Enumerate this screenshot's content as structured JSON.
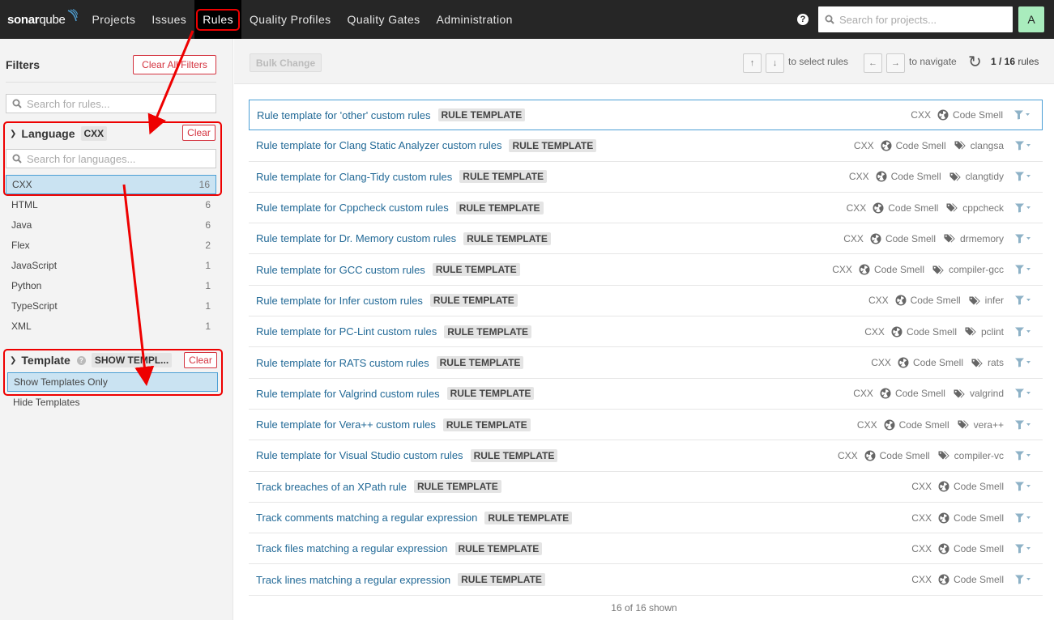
{
  "navbar": {
    "logo_sonar": "sonar",
    "logo_qube": "qube",
    "items": [
      {
        "label": "Projects"
      },
      {
        "label": "Issues"
      },
      {
        "label": "Rules",
        "active": true
      },
      {
        "label": "Quality Profiles"
      },
      {
        "label": "Quality Gates"
      },
      {
        "label": "Administration"
      }
    ],
    "help_icon": "?",
    "search_placeholder": "Search for projects...",
    "avatar_letter": "A"
  },
  "sidebar": {
    "title": "Filters",
    "clear_all_label": "Clear All Filters",
    "rule_search_placeholder": "Search for rules...",
    "language_facet": {
      "title": "Language",
      "badge": "CXX",
      "clear_label": "Clear",
      "search_placeholder": "Search for languages...",
      "items": [
        {
          "label": "CXX",
          "count": "16",
          "selected": true
        },
        {
          "label": "HTML",
          "count": "6"
        },
        {
          "label": "Java",
          "count": "6"
        },
        {
          "label": "Flex",
          "count": "2"
        },
        {
          "label": "JavaScript",
          "count": "1"
        },
        {
          "label": "Python",
          "count": "1"
        },
        {
          "label": "TypeScript",
          "count": "1"
        },
        {
          "label": "XML",
          "count": "1"
        }
      ]
    },
    "template_facet": {
      "title": "Template",
      "help": "?",
      "badge": "SHOW TEMPL...",
      "clear_label": "Clear",
      "items": [
        {
          "label": "Show Templates Only",
          "selected": true
        },
        {
          "label": "Hide Templates"
        }
      ]
    }
  },
  "toolbar": {
    "bulk_change_label": "Bulk Change",
    "key_up": "↑",
    "key_down": "↓",
    "select_hint": "to select rules",
    "key_left": "←",
    "key_right": "→",
    "navigate_hint": "to navigate",
    "refresh_icon": "↻",
    "pager_current": "1 / 16",
    "pager_suffix": "rules"
  },
  "rules": [
    {
      "name": "Rule template for 'other' custom rules",
      "badge": "RULE TEMPLATE",
      "lang": "CXX",
      "type": "Code Smell",
      "tag": ""
    },
    {
      "name": "Rule template for Clang Static Analyzer custom rules",
      "badge": "RULE TEMPLATE",
      "lang": "CXX",
      "type": "Code Smell",
      "tag": "clangsa"
    },
    {
      "name": "Rule template for Clang-Tidy custom rules",
      "badge": "RULE TEMPLATE",
      "lang": "CXX",
      "type": "Code Smell",
      "tag": "clangtidy"
    },
    {
      "name": "Rule template for Cppcheck custom rules",
      "badge": "RULE TEMPLATE",
      "lang": "CXX",
      "type": "Code Smell",
      "tag": "cppcheck"
    },
    {
      "name": "Rule template for Dr. Memory custom rules",
      "badge": "RULE TEMPLATE",
      "lang": "CXX",
      "type": "Code Smell",
      "tag": "drmemory"
    },
    {
      "name": "Rule template for GCC custom rules",
      "badge": "RULE TEMPLATE",
      "lang": "CXX",
      "type": "Code Smell",
      "tag": "compiler-gcc"
    },
    {
      "name": "Rule template for Infer custom rules",
      "badge": "RULE TEMPLATE",
      "lang": "CXX",
      "type": "Code Smell",
      "tag": "infer"
    },
    {
      "name": "Rule template for PC-Lint custom rules",
      "badge": "RULE TEMPLATE",
      "lang": "CXX",
      "type": "Code Smell",
      "tag": "pclint"
    },
    {
      "name": "Rule template for RATS custom rules",
      "badge": "RULE TEMPLATE",
      "lang": "CXX",
      "type": "Code Smell",
      "tag": "rats"
    },
    {
      "name": "Rule template for Valgrind custom rules",
      "badge": "RULE TEMPLATE",
      "lang": "CXX",
      "type": "Code Smell",
      "tag": "valgrind"
    },
    {
      "name": "Rule template for Vera++ custom rules",
      "badge": "RULE TEMPLATE",
      "lang": "CXX",
      "type": "Code Smell",
      "tag": "vera++"
    },
    {
      "name": "Rule template for Visual Studio custom rules",
      "badge": "RULE TEMPLATE",
      "lang": "CXX",
      "type": "Code Smell",
      "tag": "compiler-vc"
    },
    {
      "name": "Track breaches of an XPath rule",
      "badge": "RULE TEMPLATE",
      "lang": "CXX",
      "type": "Code Smell",
      "tag": ""
    },
    {
      "name": "Track comments matching a regular expression",
      "badge": "RULE TEMPLATE",
      "lang": "CXX",
      "type": "Code Smell",
      "tag": ""
    },
    {
      "name": "Track files matching a regular expression",
      "badge": "RULE TEMPLATE",
      "lang": "CXX",
      "type": "Code Smell",
      "tag": ""
    },
    {
      "name": "Track lines matching a regular expression",
      "badge": "RULE TEMPLATE",
      "lang": "CXX",
      "type": "Code Smell",
      "tag": ""
    }
  ],
  "footer": {
    "shown": "16 of 16 shown"
  },
  "colors": {
    "navbar_bg": "#262626",
    "link": "#236a97",
    "danger": "#d4333f",
    "selected_bg": "#cae3f2",
    "selected_border": "#4b9fd5",
    "annotation": "#ee0000",
    "filter_icon": "#8eb2c7"
  }
}
